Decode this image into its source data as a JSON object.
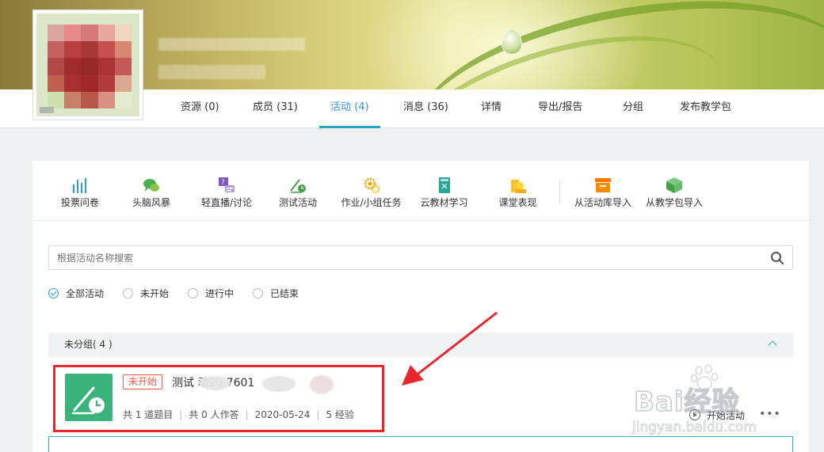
{
  "tabs": [
    {
      "label": "资源 (0)",
      "active": false
    },
    {
      "label": "成员 (31)",
      "active": false
    },
    {
      "label": "活动 (4)",
      "active": true
    },
    {
      "label": "消息 (36)",
      "active": false
    },
    {
      "label": "详情",
      "active": false
    },
    {
      "label": "导出/报告",
      "active": false
    },
    {
      "label": "分组",
      "active": false
    },
    {
      "label": "发布教学包",
      "active": false
    }
  ],
  "tools": [
    {
      "label": "投票问卷",
      "icon": "bar-chart-icon"
    },
    {
      "label": "头脑风暴",
      "icon": "chat-bubbles-icon"
    },
    {
      "label": "轻直播/讨论",
      "icon": "question-discuss-icon"
    },
    {
      "label": "测试活动",
      "icon": "test-pen-clock-icon"
    },
    {
      "label": "作业/小组任务",
      "icon": "gears-icon"
    },
    {
      "label": "云教材学习",
      "icon": "book-icon"
    },
    {
      "label": "课堂表现",
      "icon": "person-card-icon"
    },
    {
      "label": "从活动库导入",
      "icon": "archive-box-icon"
    },
    {
      "label": "从教学包导入",
      "icon": "package-cube-icon"
    }
  ],
  "search": {
    "placeholder": "根据活动名称搜索"
  },
  "filters": [
    {
      "label": "全部活动",
      "selected": true
    },
    {
      "label": "未开始",
      "selected": false
    },
    {
      "label": "进行中",
      "selected": false
    },
    {
      "label": "已结束",
      "selected": false
    }
  ],
  "group": {
    "title": "未分组( 4 )"
  },
  "activity": {
    "status": "未开始",
    "title": "测试    动20    7601",
    "questions": "共 1 道题目",
    "answers": "共 0 人作答",
    "date": "2020-05-24",
    "exp": "5 经验",
    "start_label": "开始活动",
    "more_label": "•••"
  },
  "watermark": {
    "logo": "Bai经验",
    "url": "jingyan.baidu.com"
  },
  "colors": {
    "accent": "#2b9fd8",
    "active_tab": "#3a8ee6",
    "badge": "#f05a4a",
    "thumb": "#3ab37a",
    "highlight": "#e8262e"
  }
}
